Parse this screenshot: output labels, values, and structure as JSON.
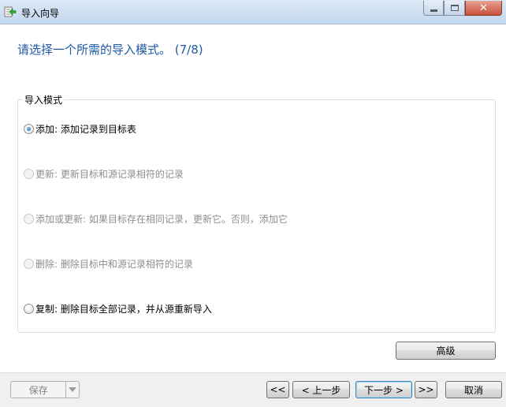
{
  "window": {
    "title": "导入向导",
    "icon": "import-wizard-icon",
    "controls": [
      "minimize-icon",
      "maximize-icon",
      "close-icon"
    ]
  },
  "heading": "请选择一个所需的导入模式。 (7/8)",
  "import_mode": {
    "legend": "导入模式",
    "options": [
      {
        "label": "添加: 添加记录到目标表",
        "selected": true,
        "enabled": true
      },
      {
        "label": "更新: 更新目标和源记录相符的记录",
        "selected": false,
        "enabled": false
      },
      {
        "label": "添加或更新: 如果目标存在相同记录，更新它。否则，添加它",
        "selected": false,
        "enabled": false
      },
      {
        "label": "删除: 删除目标中和源记录相符的记录",
        "selected": false,
        "enabled": false
      },
      {
        "label": "复制: 删除目标全部记录，并从源重新导入",
        "selected": false,
        "enabled": true
      }
    ]
  },
  "buttons": {
    "advanced": "高级",
    "save": "保存",
    "first": "<<",
    "prev": "< 上一步",
    "next": "下一步 >",
    "last": ">>",
    "cancel": "取消"
  }
}
